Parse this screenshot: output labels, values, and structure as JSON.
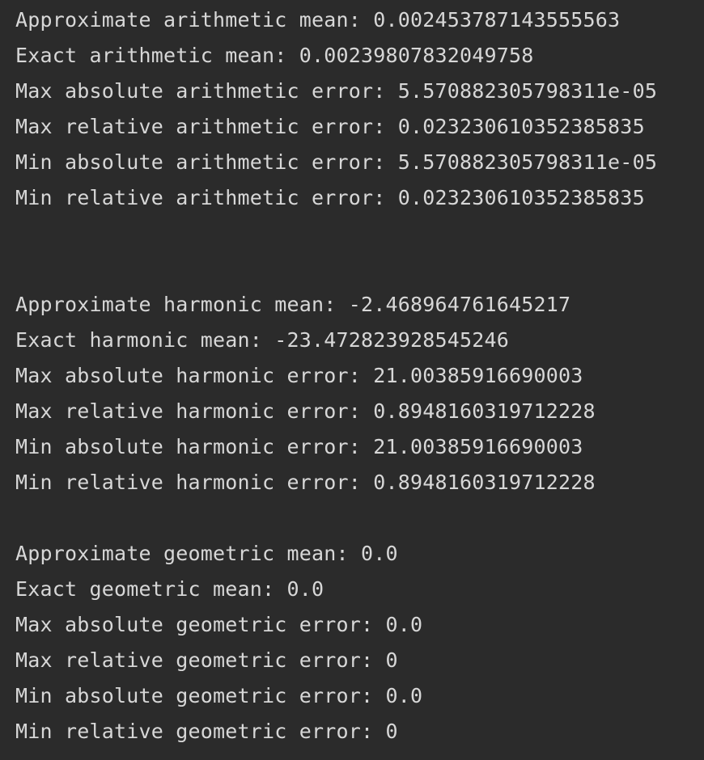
{
  "console": {
    "background": "#2b2b2b",
    "text_color": "#d7d7d7",
    "lines": [
      "Approximate arithmetic mean: 0.002453787143555563",
      "Exact arithmetic mean: 0.00239807832049758",
      "Max absolute arithmetic error: 5.570882305798311e-05",
      "Max relative arithmetic error: 0.023230610352385835",
      "Min absolute arithmetic error: 5.570882305798311e-05",
      "Min relative arithmetic error: 0.023230610352385835",
      "",
      "",
      "Approximate harmonic mean: -2.468964761645217",
      "Exact harmonic mean: -23.472823928545246",
      "Max absolute harmonic error: 21.00385916690003",
      "Max relative harmonic error: 0.8948160319712228",
      "Min absolute harmonic error: 21.00385916690003",
      "Min relative harmonic error: 0.8948160319712228",
      "",
      "Approximate geometric mean: 0.0",
      "Exact geometric mean: 0.0",
      "Max absolute geometric error: 0.0",
      "Max relative geometric error: 0",
      "Min absolute geometric error: 0.0",
      "Min relative geometric error: 0"
    ]
  }
}
